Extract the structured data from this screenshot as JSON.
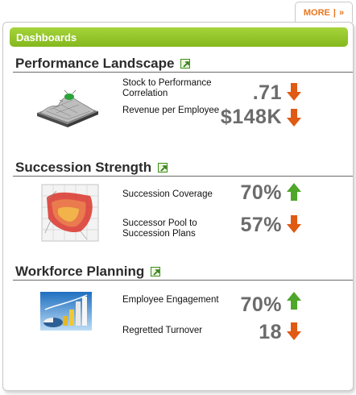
{
  "more_tab": {
    "label": "MORE",
    "sep": "|",
    "chevron": "»"
  },
  "header": {
    "title": "Dashboards"
  },
  "sections": [
    {
      "title": "Performance Landscape",
      "metrics": [
        {
          "label": "Stock to Performance Correlation",
          "value": ".71",
          "trend": "down"
        },
        {
          "label": "Revenue per Employee",
          "value": "$148K",
          "trend": "down"
        }
      ]
    },
    {
      "title": "Succession Strength",
      "metrics": [
        {
          "label": "Succession Coverage",
          "value": "70%",
          "trend": "up"
        },
        {
          "label": "Successor Pool to Succession Plans",
          "value": "57%",
          "trend": "down"
        }
      ]
    },
    {
      "title": "Workforce Planning",
      "metrics": [
        {
          "label": "Employee Engagement",
          "value": "70%",
          "trend": "up"
        },
        {
          "label": "Regretted Turnover",
          "value": "18",
          "trend": "down"
        }
      ]
    }
  ],
  "colors": {
    "up": "#4ea62a",
    "down": "#e05a14",
    "accent": "#e8761e",
    "header": "#8fc126"
  },
  "icons": {
    "external": "external-link-icon",
    "up": "arrow-up-icon",
    "down": "arrow-down-icon"
  }
}
